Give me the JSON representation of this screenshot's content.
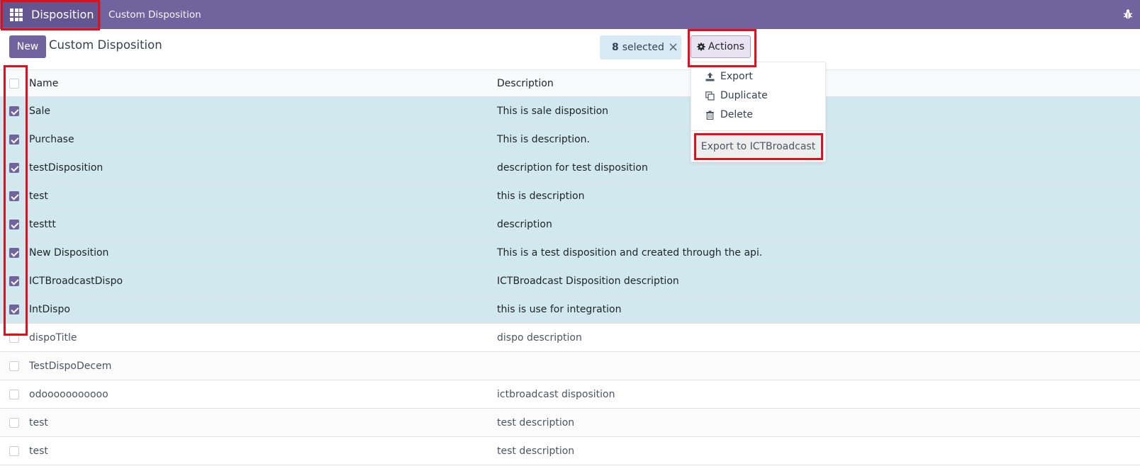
{
  "navbar": {
    "app_title": "Disposition",
    "menu_item": "Custom Disposition",
    "apps_icon": "grid-icon",
    "debug_icon": "bug-icon"
  },
  "control_panel": {
    "new_label": "New",
    "breadcrumb": "Custom Disposition",
    "selected_count": "8",
    "selected_label": "selected",
    "clear_icon": "×",
    "actions_label": "Actions"
  },
  "table": {
    "headers": {
      "name": "Name",
      "description": "Description"
    },
    "rows": [
      {
        "name": "Sale",
        "description": "This is sale disposition",
        "selected": true
      },
      {
        "name": "Purchase",
        "description": "This is description.",
        "selected": true
      },
      {
        "name": "testDisposition",
        "description": "description for test disposition",
        "selected": true
      },
      {
        "name": "test",
        "description": "this is description",
        "selected": true
      },
      {
        "name": "testtt",
        "description": "description",
        "selected": true
      },
      {
        "name": "New Disposition",
        "description": "This is a test disposition and created through the api.",
        "selected": true
      },
      {
        "name": "ICTBroadcastDispo",
        "description": "ICTBroadcast Disposition description",
        "selected": true
      },
      {
        "name": "IntDispo",
        "description": "this is use for integration",
        "selected": true
      },
      {
        "name": "dispoTitle",
        "description": "dispo description",
        "selected": false
      },
      {
        "name": "TestDispoDecem",
        "description": "",
        "selected": false
      },
      {
        "name": "odooooooooooo",
        "description": "ictbroadcast disposition",
        "selected": false
      },
      {
        "name": "test",
        "description": "test description",
        "selected": false
      },
      {
        "name": "test",
        "description": "test description",
        "selected": false
      }
    ]
  },
  "actions_menu": {
    "export": "Export",
    "duplicate": "Duplicate",
    "delete": "Delete",
    "export_ict": "Export to ICTBroadcast"
  },
  "colors": {
    "brand": "#71639e",
    "selected_row": "#d1e9ee",
    "annotation": "#e0101a"
  }
}
